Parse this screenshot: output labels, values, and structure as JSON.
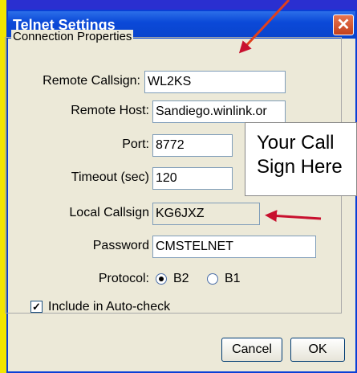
{
  "window": {
    "title": "Telnet Settings",
    "close_glyph": "✕"
  },
  "group": {
    "label": "Connection Properties"
  },
  "fields": {
    "remote_callsign": {
      "label": "Remote Callsign:",
      "value": "WL2KS"
    },
    "remote_host": {
      "label": "Remote Host:",
      "value": "Sandiego.winlink.or"
    },
    "port": {
      "label": "Port:",
      "value": "8772"
    },
    "timeout": {
      "label": "Timeout (sec)",
      "value": "120"
    },
    "local_callsign": {
      "label": "Local Callsign",
      "value": "KG6JXZ"
    },
    "password": {
      "label": "Password",
      "value": "CMSTELNET"
    }
  },
  "protocol": {
    "label": "Protocol:",
    "options": [
      "B2",
      "B1"
    ],
    "selected": "B2"
  },
  "auto_check": {
    "label": "Include in Auto-check",
    "checked": true,
    "check_glyph": "✓"
  },
  "buttons": {
    "cancel": "Cancel",
    "ok": "OK"
  },
  "annotation": {
    "callout_line1": "Your Call",
    "callout_line2": "Sign Here"
  },
  "colors": {
    "arrow": "#c8102e",
    "title_bar": "#0a44cc",
    "dialog_bg": "#ece9d8"
  }
}
